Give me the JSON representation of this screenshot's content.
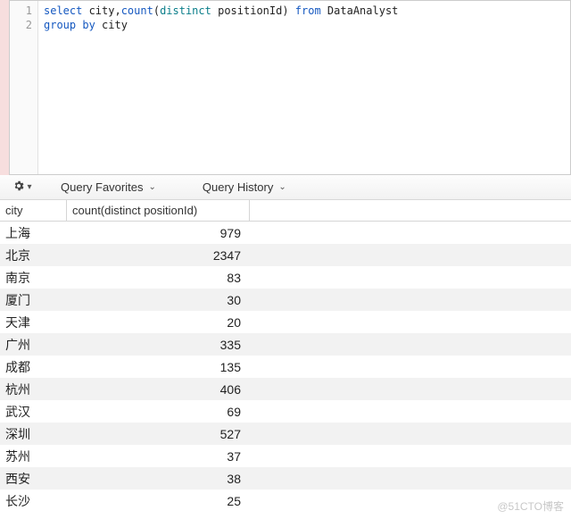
{
  "editor": {
    "lines": [
      "1",
      "2"
    ],
    "code": {
      "tokens": [
        [
          {
            "t": "select ",
            "c": "kw-blue"
          },
          {
            "t": "city,",
            "c": "ident"
          },
          {
            "t": "count",
            "c": "kw-blue"
          },
          {
            "t": "(",
            "c": "ident"
          },
          {
            "t": "distinct ",
            "c": "kw-teal"
          },
          {
            "t": "positionId) ",
            "c": "ident"
          },
          {
            "t": "from ",
            "c": "kw-blue"
          },
          {
            "t": "DataAnalyst",
            "c": "ident"
          }
        ],
        [
          {
            "t": "group by ",
            "c": "kw-blue"
          },
          {
            "t": "city",
            "c": "ident"
          }
        ]
      ]
    }
  },
  "toolbar": {
    "favorites_label": "Query Favorites",
    "history_label": "Query History"
  },
  "columns": {
    "city": "city",
    "count": "count(distinct positionId)"
  },
  "rows": [
    {
      "city": "上海",
      "count": "979"
    },
    {
      "city": "北京",
      "count": "2347"
    },
    {
      "city": "南京",
      "count": "83"
    },
    {
      "city": "厦门",
      "count": "30"
    },
    {
      "city": "天津",
      "count": "20"
    },
    {
      "city": "广州",
      "count": "335"
    },
    {
      "city": "成都",
      "count": "135"
    },
    {
      "city": "杭州",
      "count": "406"
    },
    {
      "city": "武汉",
      "count": "69"
    },
    {
      "city": "深圳",
      "count": "527"
    },
    {
      "city": "苏州",
      "count": "37"
    },
    {
      "city": "西安",
      "count": "38"
    },
    {
      "city": "长沙",
      "count": "25"
    }
  ],
  "chart_data": {
    "type": "table",
    "columns": [
      "city",
      "count(distinct positionId)"
    ],
    "rows": [
      [
        "上海",
        979
      ],
      [
        "北京",
        2347
      ],
      [
        "南京",
        83
      ],
      [
        "厦门",
        30
      ],
      [
        "天津",
        20
      ],
      [
        "广州",
        335
      ],
      [
        "成都",
        135
      ],
      [
        "杭州",
        406
      ],
      [
        "武汉",
        69
      ],
      [
        "深圳",
        527
      ],
      [
        "苏州",
        37
      ],
      [
        "西安",
        38
      ],
      [
        "长沙",
        25
      ]
    ]
  },
  "watermark": "@51CTO博客"
}
